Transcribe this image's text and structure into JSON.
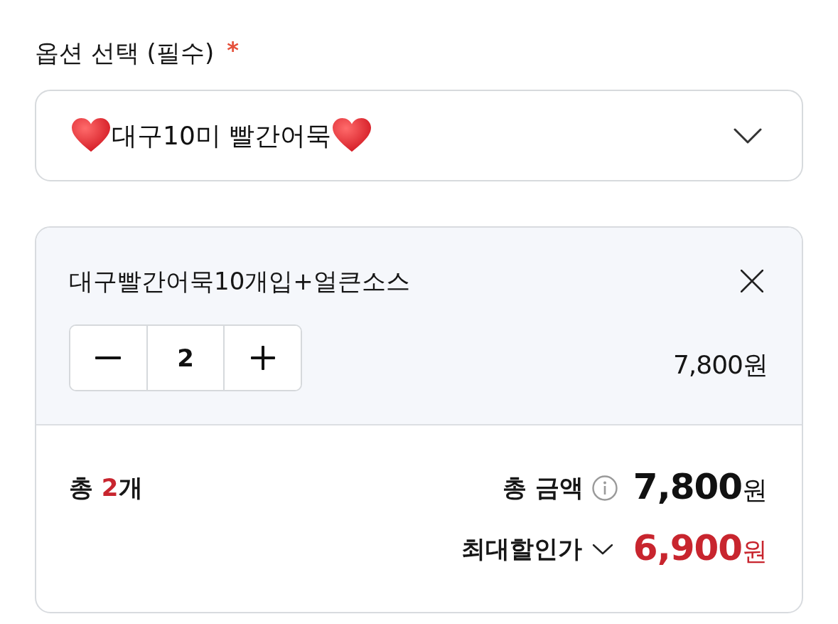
{
  "option_select": {
    "label": "옵션 선택 (필수)",
    "required_mark": "*",
    "value": "대구10미 빨간어묵",
    "expanded": false
  },
  "selected_item": {
    "name": "대구빨간어묵10개입+얼큰소스",
    "quantity": "2",
    "price": "7,800원"
  },
  "summary": {
    "count_prefix": "총",
    "count": "2",
    "count_suffix": "개",
    "total_label": "총 금액",
    "total_amount": "7,800",
    "total_unit": "원",
    "discount_label": "최대할인가",
    "discount_expanded": false,
    "discount_amount": "6,900",
    "discount_unit": "원"
  }
}
